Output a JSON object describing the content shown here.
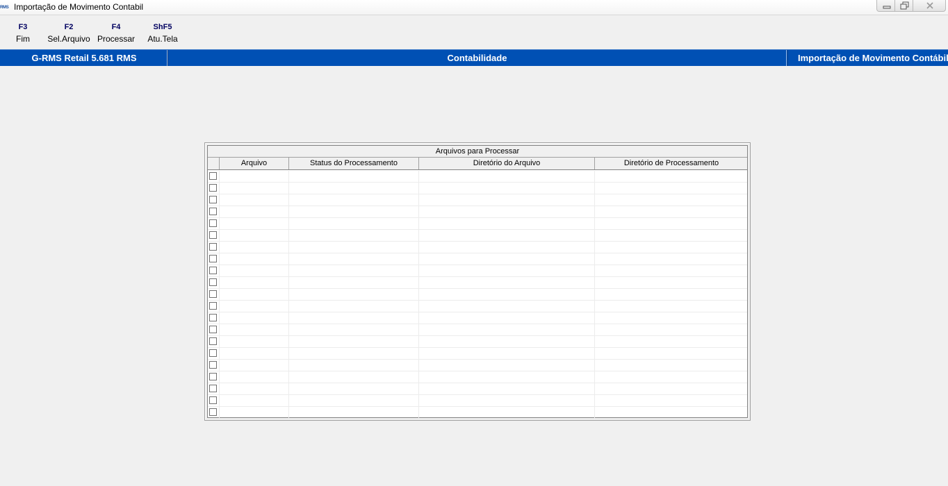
{
  "window": {
    "app_icon": "RMS",
    "title": "Importação de Movimento Contabil"
  },
  "toolbar": {
    "items": [
      {
        "key": "F3",
        "label": "Fim"
      },
      {
        "key": "F2",
        "label": "Sel.Arquivo"
      },
      {
        "key": "F4",
        "label": "Processar"
      },
      {
        "key": "ShF5",
        "label": "Atu.Tela"
      }
    ]
  },
  "header": {
    "product": "G-RMS Retail 5.681 RMS",
    "module": "Contabilidade",
    "screen": "Importação de Movimento Contábil"
  },
  "grid": {
    "caption": "Arquivos para Processar",
    "columns": [
      "Arquivo",
      "Status do Processamento",
      "Diretório do Arquivo",
      "Diretório de Processamento"
    ],
    "row_count": 21
  },
  "colors": {
    "header_bar": "#0050b4",
    "background": "#f0f0f0",
    "toolbar_key": "#000060"
  },
  "icons": {
    "minimize": "minimize-icon",
    "restore": "restore-icon",
    "close": "close-icon"
  }
}
